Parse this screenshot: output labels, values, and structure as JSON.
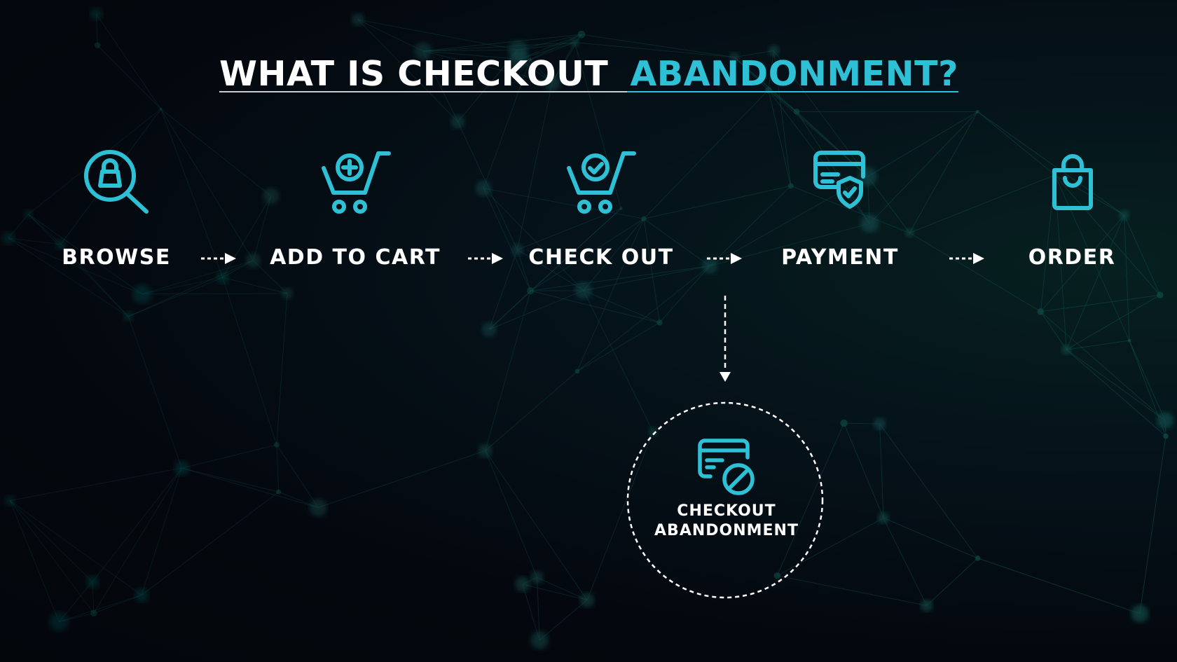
{
  "title": {
    "part1": "WHAT IS CHECKOUT",
    "part2": "ABANDONMENT?"
  },
  "colors": {
    "accent": "#2ec1d6",
    "text": "#ffffff",
    "background": "#04080e",
    "network": "#0f4a48"
  },
  "steps": [
    {
      "label": "BROWSE",
      "icon": "magnifier-lock-icon"
    },
    {
      "label": "ADD TO CART",
      "icon": "cart-plus-icon"
    },
    {
      "label": "CHECK OUT",
      "icon": "cart-check-icon"
    },
    {
      "label": "PAYMENT",
      "icon": "card-shield-icon"
    },
    {
      "label": "ORDER",
      "icon": "shopping-bag-icon"
    }
  ],
  "branch": {
    "from_step": "CHECK OUT",
    "label_line1": "CHECKOUT",
    "label_line2": "ABANDONMENT",
    "icon": "card-blocked-icon"
  }
}
